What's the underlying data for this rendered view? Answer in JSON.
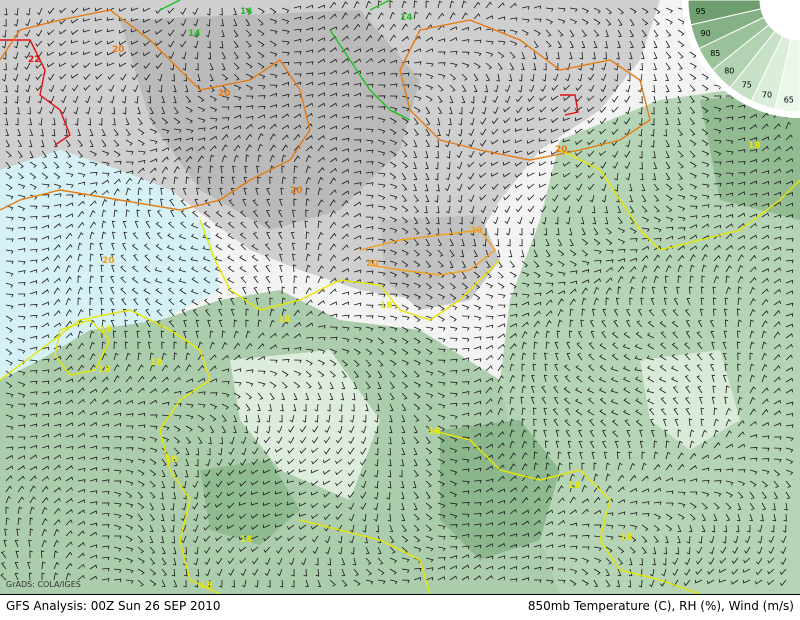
{
  "footer": {
    "left": "GFS Analysis: 00Z Sun 26 SEP 2010",
    "right": "850mb Temperature (C), RH (%), Wind (m/s)"
  },
  "credit": "GrADS: COLA/IGES",
  "legend": {
    "labels": [
      "95",
      "90",
      "85",
      "80",
      "75",
      "70",
      "65"
    ],
    "colors": [
      "#6f9f6f",
      "#86b186",
      "#9cc29c",
      "#b2d2b2",
      "#c7e1c7",
      "#daeeda",
      "#ebf7eb"
    ]
  },
  "colors": {
    "dry_gray": "#c9c9c9",
    "dry_gray_dark": "#a9a9a9",
    "moist_green": "#9cc49c",
    "moist_green_dark": "#7fae7f",
    "cyan": "#d8f2f7",
    "contour_yellow": "#e6e600",
    "contour_orange": "#f0a020",
    "contour_darkorange": "#e67a10",
    "contour_red": "#e01010",
    "contour_green": "#20c020"
  },
  "contours": {
    "labels": [
      "22",
      "20",
      "20",
      "20",
      "20",
      "20",
      "20",
      "20",
      "18",
      "18",
      "18",
      "18",
      "18",
      "18",
      "18",
      "18",
      "18",
      "18",
      "18",
      "16",
      "14",
      "14",
      "14"
    ]
  }
}
